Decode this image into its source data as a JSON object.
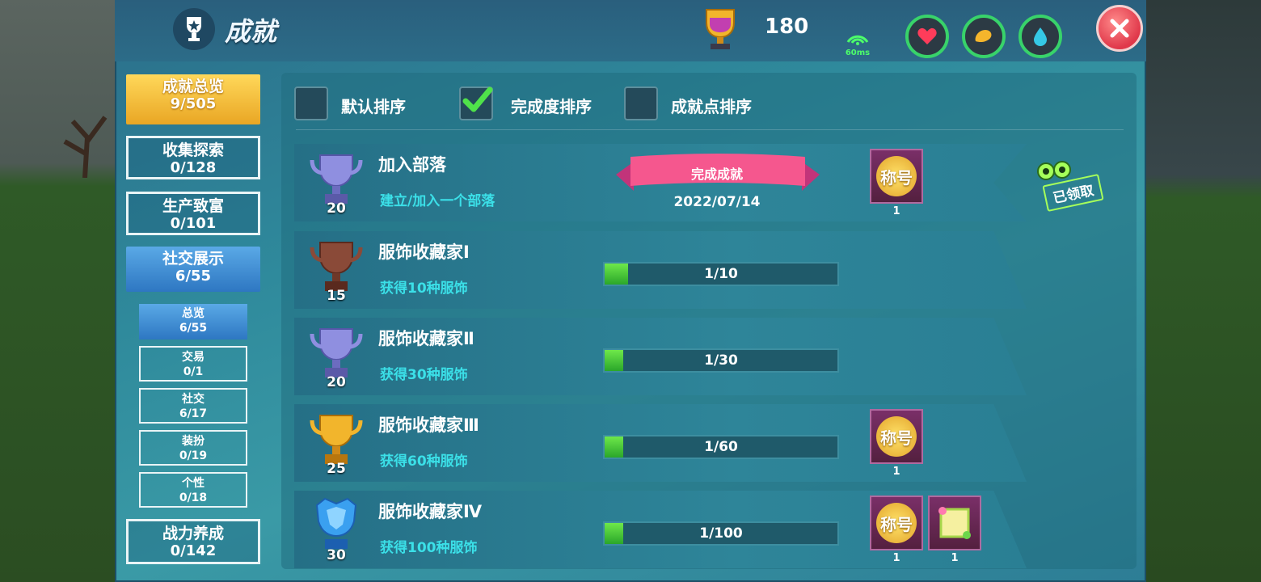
{
  "header": {
    "title": "成就",
    "points": "180",
    "ping": "60ms"
  },
  "sidebar": {
    "categories": [
      {
        "label": "成就总览",
        "count": "9/505"
      },
      {
        "label": "收集探索",
        "count": "0/128"
      },
      {
        "label": "生产致富",
        "count": "0/101"
      },
      {
        "label": "社交展示",
        "count": "6/55"
      },
      {
        "label": "战力养成",
        "count": "0/142"
      }
    ],
    "subcategories": [
      {
        "label": "总览",
        "count": "6/55"
      },
      {
        "label": "交易",
        "count": "0/1"
      },
      {
        "label": "社交",
        "count": "6/17"
      },
      {
        "label": "装扮",
        "count": "0/19"
      },
      {
        "label": "个性",
        "count": "0/18"
      }
    ]
  },
  "sort": {
    "default": "默认排序",
    "completion": "完成度排序",
    "points": "成就点排序"
  },
  "achievements": [
    {
      "name": "加入部落",
      "desc": "建立/加入一个部落",
      "points": "20",
      "status": "完成成就",
      "date": "2022/07/14",
      "reward_label": "称号",
      "reward_count": "1",
      "claimed": "已领取"
    },
    {
      "name": "服饰收藏家Ⅰ",
      "desc": "获得10种服饰",
      "points": "15",
      "progress_text": "1/10",
      "progress": 0.1
    },
    {
      "name": "服饰收藏家Ⅱ",
      "desc": "获得30种服饰",
      "points": "20",
      "progress_text": "1/30",
      "progress": 0.033
    },
    {
      "name": "服饰收藏家Ⅲ",
      "desc": "获得60种服饰",
      "points": "25",
      "progress_text": "1/60",
      "progress": 0.017,
      "reward_label": "称号",
      "reward_count": "1"
    },
    {
      "name": "服饰收藏家Ⅳ",
      "desc": "获得100种服饰",
      "points": "30",
      "progress_text": "1/100",
      "progress": 0.01,
      "reward_label": "称号",
      "reward_count": "1",
      "reward2_count": "1"
    }
  ]
}
